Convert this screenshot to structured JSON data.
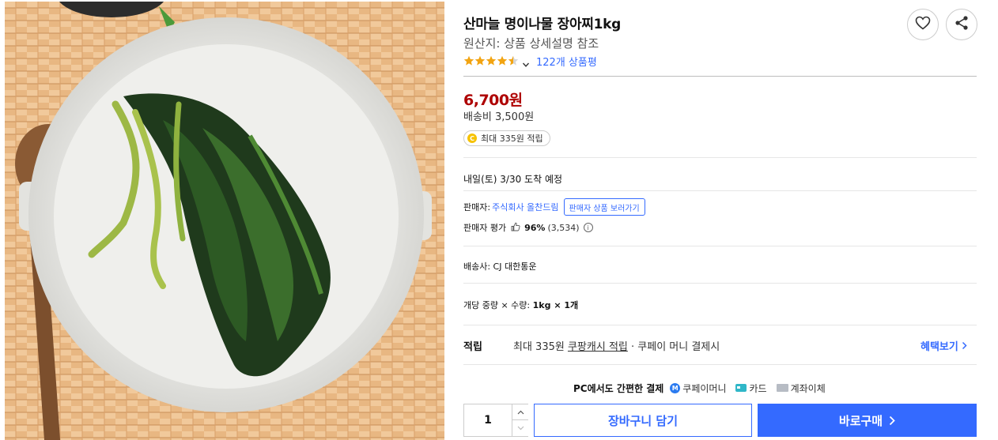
{
  "product": {
    "title": "산마늘 명이나물 장아찌1kg",
    "origin": "원산지: 상품 상세설명 참조",
    "rating_value": 4.5,
    "review_count_label": "122개 상품평",
    "price": "6,700원",
    "shipping_fee": "배송비 3,500원",
    "reward_label": "최대 335원 적립",
    "coin_symbol": "C"
  },
  "delivery": {
    "arrival": "내일(토) 3/30 도착 예정"
  },
  "seller": {
    "prefix": "판매자:",
    "name": "주식회사 올찬드림",
    "view_products": "판매자 상품 보러가기",
    "rating_prefix": "판매자 평가",
    "rating_percent": "96%",
    "rating_count": "(3,534)",
    "info_symbol": "i"
  },
  "courier": "배송사: CJ 대한통운",
  "weight": {
    "label": "개당 중량 × 수량:",
    "value": "1kg × 1개"
  },
  "benefit": {
    "label": "적립",
    "text_prefix": "최대 335원 ",
    "text_link": "쿠팡캐시 적립",
    "text_suffix": " · 쿠페이 머니 결제시",
    "more": "혜택보기"
  },
  "payment": {
    "title": "PC에서도 간편한 결제",
    "coupay_badge": "M",
    "coupay": "쿠페이머니",
    "card": "카드",
    "bank": "계좌이체"
  },
  "purchase": {
    "quantity": "1",
    "cart_button": "장바구니 담기",
    "buy_button": "바로구매"
  },
  "colors": {
    "accent": "#346aff",
    "price": "#ae0000",
    "star": "#f2a412"
  },
  "icons": [
    "heart-icon",
    "share-icon",
    "star-icon",
    "chevron-down-icon",
    "thumbs-up-icon",
    "info-icon",
    "chevron-right-icon",
    "chevron-up-icon"
  ]
}
